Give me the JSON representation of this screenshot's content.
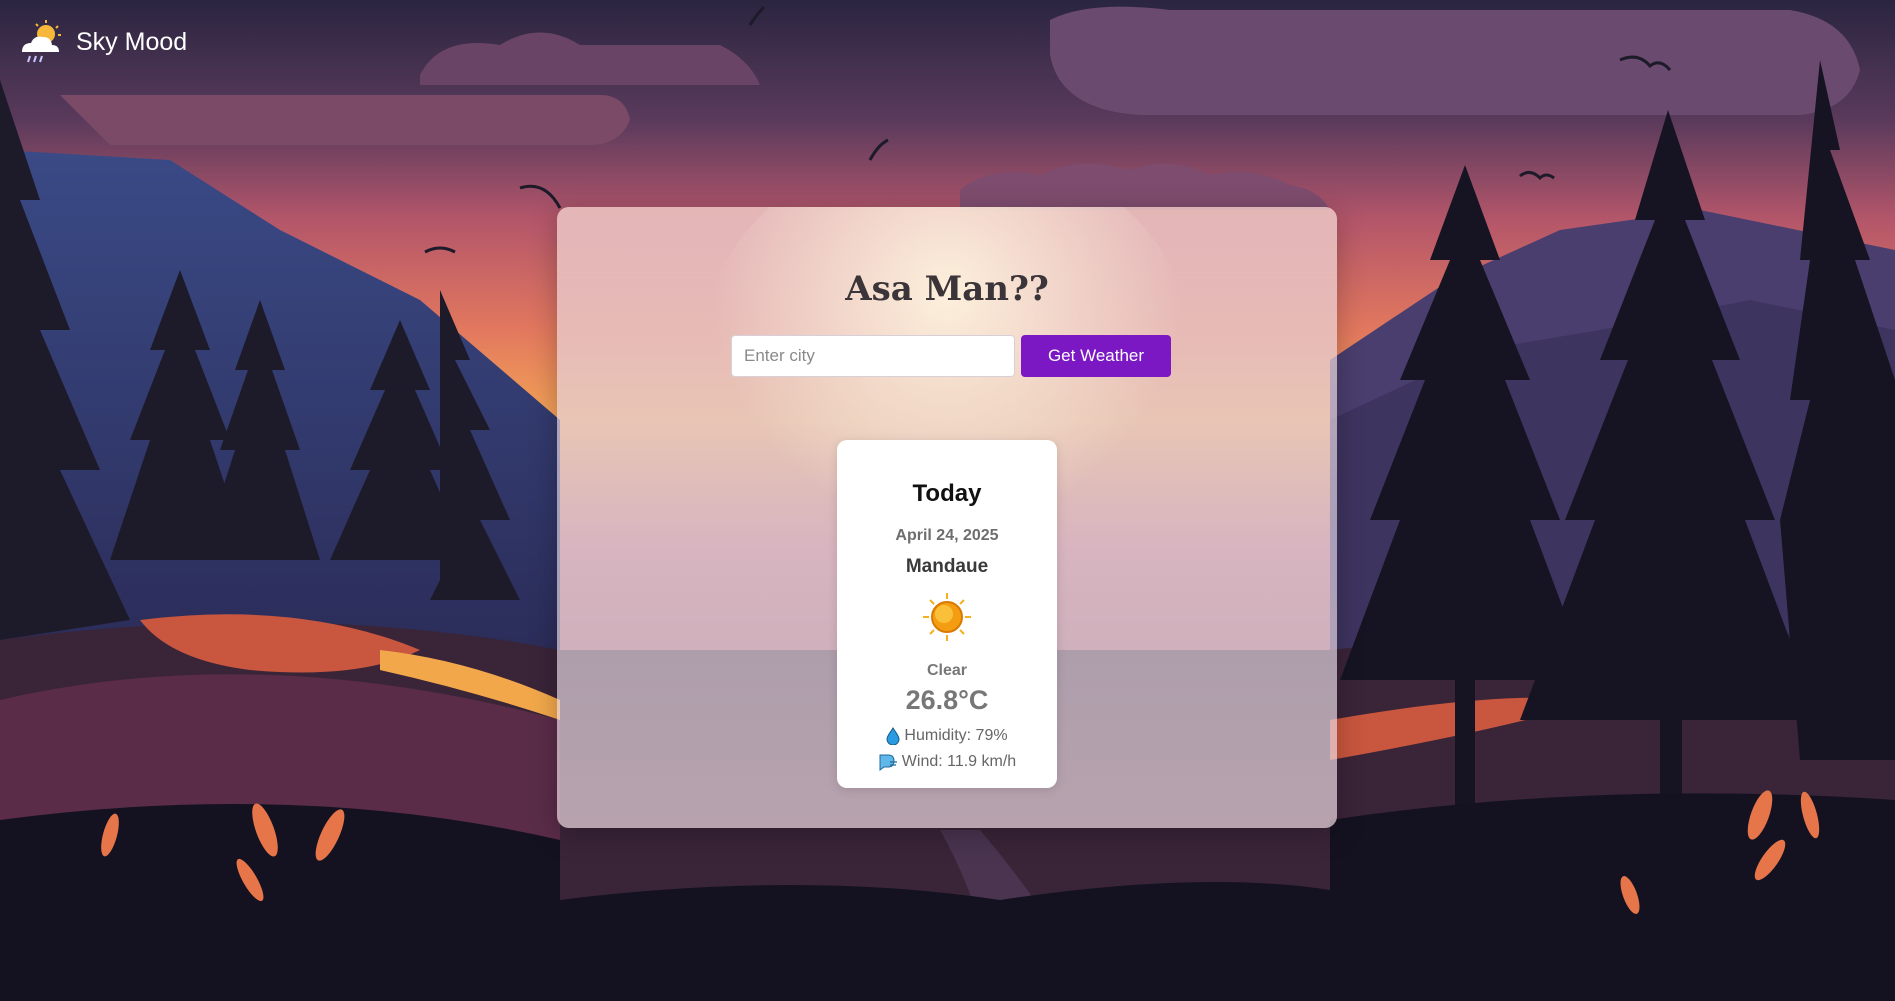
{
  "brand": {
    "name": "Sky Mood",
    "icon": "cloud-sun-rain-icon"
  },
  "panel": {
    "title": "Asa Man??",
    "search": {
      "placeholder": "Enter city",
      "value": "",
      "button_label": "Get Weather"
    }
  },
  "forecast": {
    "day_label": "Today",
    "date": "April 24, 2025",
    "city": "Mandaue",
    "icon": "sun-icon",
    "condition": "Clear",
    "temperature": "26.8°C",
    "humidity": "Humidity: 79%",
    "wind": "Wind: 11.9 km/h"
  },
  "colors": {
    "accent": "#7b18c4",
    "sky_top": "#2a2540",
    "sky_sunset": "#f09a4e"
  }
}
